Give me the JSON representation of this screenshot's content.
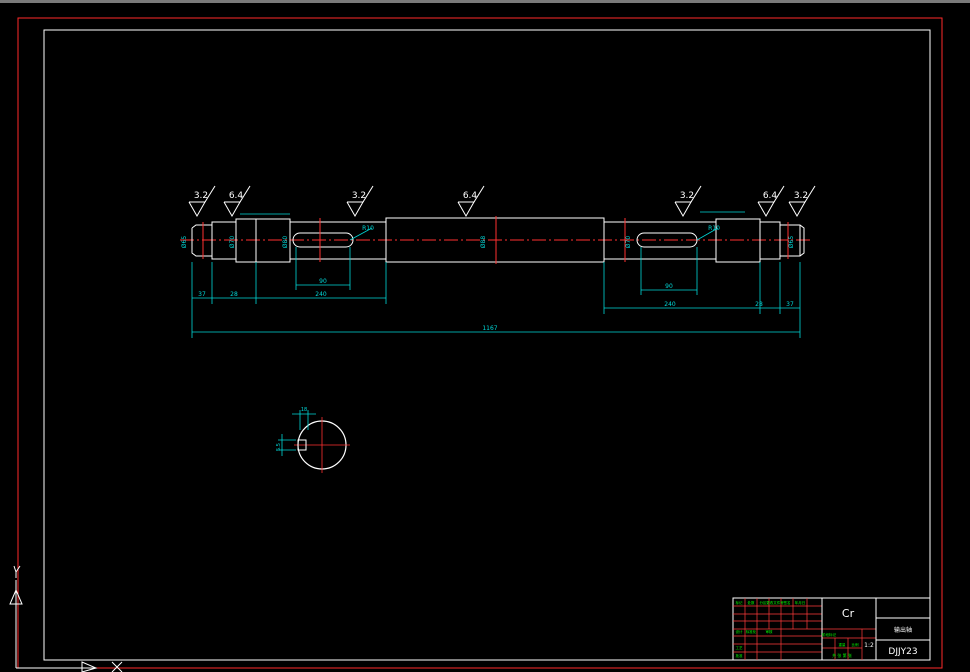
{
  "colors": {
    "background": "#000000",
    "outer_frame": "#ff2a2a",
    "inner_frame": "#ffffff",
    "outline": "#ffffff",
    "dimension": "#00d8d8",
    "centerline": "#ff3030",
    "title_grid": "#ff3b3b",
    "title_text": "#00ff00",
    "label": "#ffffff"
  },
  "roughness": [
    {
      "value": "3.2"
    },
    {
      "value": "6.4"
    },
    {
      "value": "3.2"
    },
    {
      "value": "6.4"
    },
    {
      "value": "3.2"
    },
    {
      "value": "6.4"
    },
    {
      "value": "3.2"
    }
  ],
  "dimensions": {
    "total_length": "1167",
    "left_segments": [
      "37",
      "28",
      "240"
    ],
    "right_segments": [
      "240",
      "28",
      "37"
    ],
    "keyway_lengths": [
      "90",
      "90"
    ],
    "keyway_widths": [
      "R10",
      "R10"
    ],
    "diameters": [
      "Ø65",
      "Ø70",
      "Ø80",
      "Ø88",
      "Ø70",
      "Ø65"
    ],
    "section_width": "18",
    "section_depth": "5.5"
  },
  "title_block": {
    "material": "Cr",
    "part_name": "输出轴",
    "drawing_number": "DJJY23",
    "scale": "1:2",
    "sheet_label": "共 张 第 张",
    "small_labels": [
      "标记",
      "处数",
      "分区",
      "更改文件号",
      "签名",
      "年月日",
      "设计",
      "标准化",
      "审核",
      "工艺",
      "批准",
      "阶段标记",
      "重量",
      "比例"
    ]
  },
  "ucs": {
    "y_label": "Y",
    "x_label": "X"
  }
}
